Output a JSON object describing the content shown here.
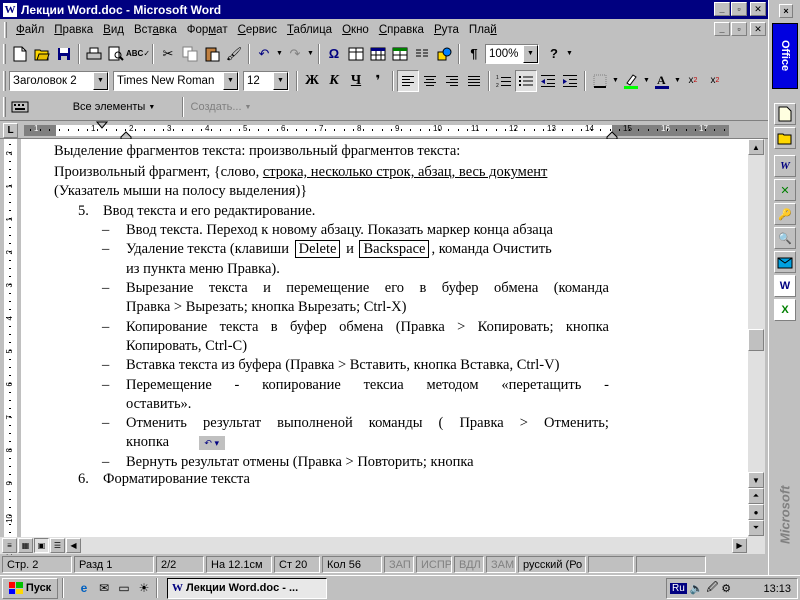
{
  "window": {
    "title": "Лекции Word.doc - Microsoft Word",
    "min": "_",
    "max": "▫",
    "close": "✕"
  },
  "menu": {
    "items": [
      {
        "pre": "",
        "u": "Ф",
        "post": "айл"
      },
      {
        "pre": "",
        "u": "П",
        "post": "равка"
      },
      {
        "pre": "",
        "u": "В",
        "post": "ид"
      },
      {
        "pre": "Вст",
        "u": "а",
        "post": "вка"
      },
      {
        "pre": "Фор",
        "u": "м",
        "post": "ат"
      },
      {
        "pre": "",
        "u": "С",
        "post": "ервис"
      },
      {
        "pre": "",
        "u": "Т",
        "post": "аблица"
      },
      {
        "pre": "",
        "u": "О",
        "post": "кно"
      },
      {
        "pre": "",
        "u": "С",
        "post": "правка"
      },
      {
        "pre": "",
        "u": "Р",
        "post": "ута"
      },
      {
        "pre": "Пла",
        "u": "й",
        "post": ""
      }
    ]
  },
  "toolbar": {
    "zoom": "100%",
    "style": "Заголовок 2",
    "font": "Times New Roman",
    "size": "12",
    "bold": "Ж",
    "italic": "К",
    "underline": "Ч",
    "all_elements": "Все элементы",
    "create": "Создать..."
  },
  "ruler": {
    "numbers": [
      "1",
      "1",
      "2",
      "3",
      "4",
      "5",
      "6",
      "7",
      "8",
      "9",
      "10",
      "11",
      "12",
      "13",
      "14",
      "15",
      "16",
      "17"
    ],
    "vnumbers": [
      "2",
      "1",
      "1",
      "2",
      "3",
      "4",
      "5",
      "6",
      "7",
      "8",
      "9",
      "10",
      "11"
    ]
  },
  "document": {
    "l1": "Выделение фрагментов текста: произвольный фрагментов текста:",
    "l2a": "Произвольный фрагмент, {слово, ",
    "l2b": "строка, несколько строк, абзац, весь документ",
    "l3": "(Указатель мыши на полосу выделения)}",
    "item5_num": "5.",
    "item5_text": "Ввод текста и его редактирование.",
    "dash": "–",
    "b1": "Ввод текста. Переход к новому абзацу. Показать маркер конца абзаца",
    "b2a": "Удаление текста (клавиши",
    "b2key1": "Delete",
    "b2mid": "и",
    "b2key2": "Backspace",
    "b2b": ", команда Очистить",
    "b2c": "из пункта меню Правка).",
    "b3a": [
      "Вырезание",
      "текста",
      "и",
      "перемещение",
      "его",
      "в",
      "буфер",
      "обмена",
      "(команда"
    ],
    "b3b": "Правка > Вырезать; кнопка Вырезать; Ctrl-X)",
    "b4a": [
      "Копирование",
      "текста",
      "в",
      "буфер",
      "обмена",
      "(Правка",
      ">",
      "Копировать;",
      "кнопка"
    ],
    "b4b": "Копировать, Ctrl-C)",
    "b5": "Вставка текста из буфера (Правка > Вставить, кнопка Вставка, Ctrl-V)",
    "b6a": [
      "Перемещение",
      "-",
      "копирование",
      "тексиа",
      "методом",
      "«перетащить",
      "-"
    ],
    "b6b": "оставить».",
    "b7a": [
      "Отменить",
      "результат",
      "выполненой",
      "команды",
      "(",
      "Правка",
      ">",
      "Отменить;"
    ],
    "b7b": "кнопка",
    "b8": "Вернуть результат отмены (Правка > Повторить; кнопка",
    "item6_num": "6.",
    "item6_text": "Форматирование текста"
  },
  "status": {
    "page": "Стр. 2",
    "section": "Разд 1",
    "pages": "2/2",
    "pos": "На 12.1см",
    "line": "Ст 20",
    "col": "Кол 56",
    "rec": "ЗАП",
    "trk": "ИСПР",
    "ext": "ВДЛ",
    "ovr": "ЗАМ",
    "lang": "русский (Ро"
  },
  "office": {
    "label": "Office",
    "brand": "Microsoft"
  },
  "taskbar": {
    "start": "Пуск",
    "task": "Лекции Word.doc - ...",
    "lang": "Ru",
    "clock": "13:13"
  },
  "colors": {
    "titlebar": "#000080",
    "face": "#c0c0c0",
    "office_tab": "#0000e0"
  }
}
